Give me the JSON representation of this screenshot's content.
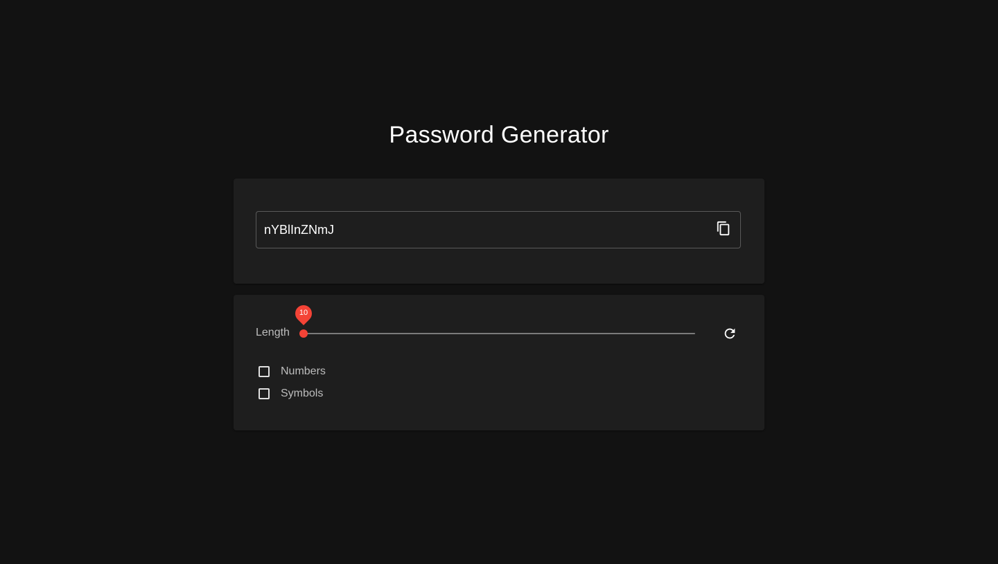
{
  "header": {
    "title": "Password Generator"
  },
  "output": {
    "password": "nYBlInZNmJ",
    "copy_icon": "copy-icon"
  },
  "options": {
    "length_label": "Length",
    "length": {
      "value": 10,
      "min": 10,
      "max": 50
    },
    "refresh_icon": "refresh-icon",
    "checkboxes": [
      {
        "label": "Numbers",
        "checked": false
      },
      {
        "label": "Symbols",
        "checked": false
      }
    ]
  },
  "colors": {
    "background": "#121212",
    "card": "#1e1e1e",
    "accent": "#f44336",
    "text": "#ffffff",
    "muted_text": "#bdbdbd"
  }
}
